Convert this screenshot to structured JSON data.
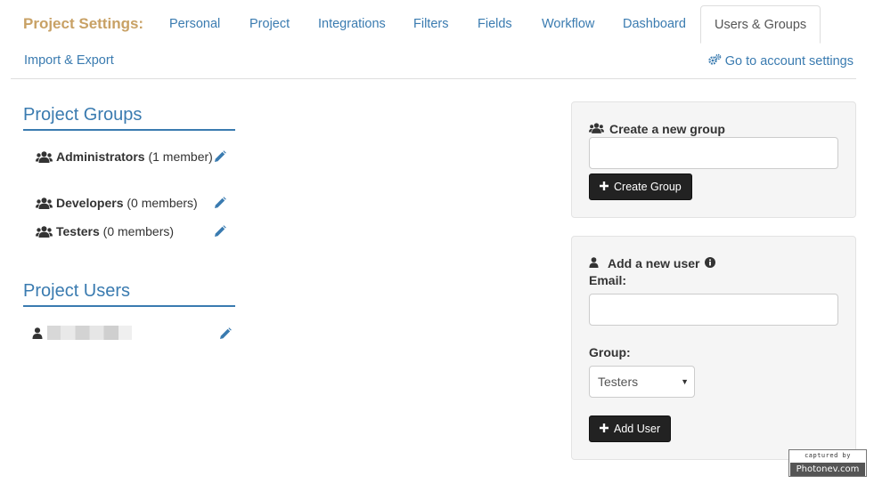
{
  "nav": {
    "brand": "Project Settings:",
    "tabs": [
      {
        "label": "Personal"
      },
      {
        "label": "Project"
      },
      {
        "label": "Integrations"
      },
      {
        "label": "Filters"
      },
      {
        "label": "Fields"
      },
      {
        "label": "Workflow"
      },
      {
        "label": "Dashboard"
      },
      {
        "label": "Users & Groups",
        "active": true
      },
      {
        "label": "Import & Export"
      }
    ],
    "account_link": "Go to account settings"
  },
  "groups": {
    "title": "Project Groups",
    "items": [
      {
        "name": "Administrators",
        "members": "(1 member)"
      },
      {
        "name": "Developers",
        "members": "(0 members)"
      },
      {
        "name": "Testers",
        "members": "(0 members)"
      }
    ]
  },
  "users": {
    "title": "Project Users"
  },
  "create_group": {
    "heading": "Create a new group",
    "input_value": "",
    "button_label": "Create Group"
  },
  "add_user": {
    "heading": "Add a new user",
    "email_label": "Email:",
    "email_value": "",
    "group_label": "Group:",
    "group_selected": "Testers",
    "button_label": "Add User"
  },
  "watermark": {
    "top": "captured by",
    "bottom": "Photonev.com"
  },
  "colors": {
    "brand": "#c8a165",
    "link": "#3a7bb0",
    "panel_bg": "#f5f5f5",
    "button_dark": "#222222"
  },
  "icons": {
    "group": "users-icon",
    "user": "user-icon",
    "edit": "pencil-icon",
    "settings": "cogs-icon",
    "info": "info-circle-icon",
    "plus": "plus-icon"
  }
}
